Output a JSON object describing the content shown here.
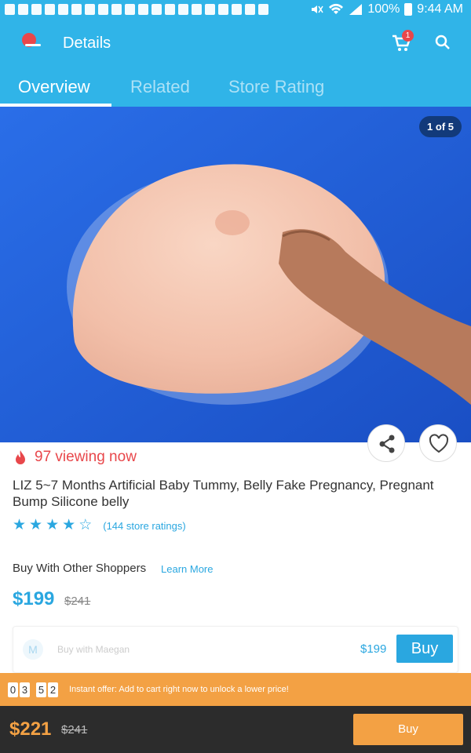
{
  "status": {
    "battery": "100%",
    "time": "9:44 AM"
  },
  "app_bar": {
    "title": "Details",
    "cart_count": "1"
  },
  "tabs": [
    {
      "label": "Overview",
      "active": true
    },
    {
      "label": "Related",
      "active": false
    },
    {
      "label": "Store Rating",
      "active": false
    }
  ],
  "product": {
    "image_counter": "1 of 5",
    "viewing": "97 viewing now",
    "title": "LIZ 5~7 Months Artificial Baby Tummy, Belly Fake Pregnancy, Pregnant Bump Silicone belly",
    "rating_stars": 4,
    "rating_count": "(144 store ratings)"
  },
  "group_buy": {
    "heading": "Buy With Other Shoppers",
    "learn_more": "Learn More",
    "price": "$199",
    "original_price": "$241",
    "shopper_initial": "M",
    "shopper_label": "Buy with Maegan",
    "shopper_price": "$199",
    "shopper_buy_label": "Buy"
  },
  "offer": {
    "timer": [
      "0",
      "3",
      "5",
      "2"
    ],
    "text": "Instant offer: Add to cart right now to unlock a lower price!"
  },
  "bottom": {
    "price": "$221",
    "original_price": "$241",
    "buy_label": "Buy"
  },
  "colors": {
    "accent": "#30b4e8",
    "link": "#2aa7e0",
    "offer": "#f3a144",
    "alert": "#e8474b"
  }
}
